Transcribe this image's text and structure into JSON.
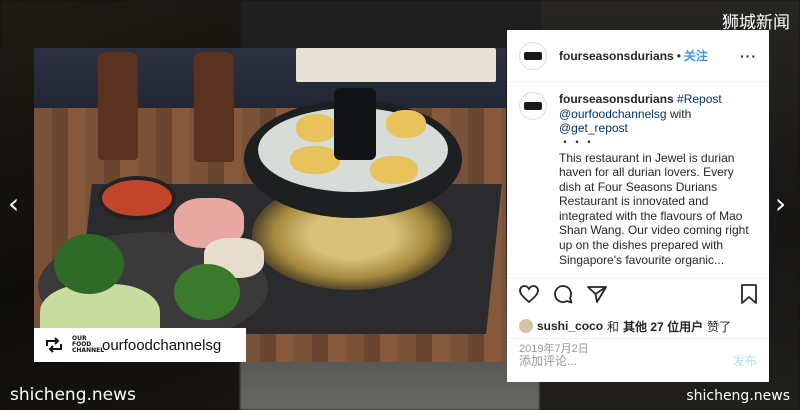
{
  "watermarks": {
    "top_right": "狮城新闻",
    "bottom_left": "shicheng.news",
    "bottom_right": "shicheng.news"
  },
  "nav": {
    "prev_icon": "chevron-left-icon",
    "next_icon": "chevron-right-icon"
  },
  "photo": {
    "repost_handle": "ourfoodchannelsg",
    "logo_text": "OUR FOOD CHANNEL"
  },
  "post": {
    "header": {
      "username": "fourseasonsdurians",
      "separator": "•",
      "follow_label": "关注",
      "more_label": "···"
    },
    "caption": {
      "username": "fourseasonsdurians",
      "hashtag": "#Repost",
      "mention1": "@ourfoodchannelsg",
      "with_text": "with",
      "mention2": "@get_repost",
      "dots": "・・・",
      "body": "This restaurant in Jewel is durian haven for all durian lovers. Every dish at Four Seasons Durians Restaurant is innovated and integrated with the flavours of Mao Shan Wang. Our video coming right up on the dishes prepared with Singapore's favourite organic..."
    },
    "actions": [
      "heart-icon",
      "comment-icon",
      "share-icon",
      "bookmark-icon"
    ],
    "likes": {
      "user": "sushi_coco",
      "and": "和",
      "others": "其他 27 位用户",
      "suffix": "赞了"
    },
    "date": "2019年7月2日",
    "comment": {
      "placeholder": "添加评论...",
      "post_label": "发布"
    }
  },
  "colors": {
    "link": "#003569",
    "follow": "#3897f0",
    "post_disabled": "#b2dffc"
  }
}
